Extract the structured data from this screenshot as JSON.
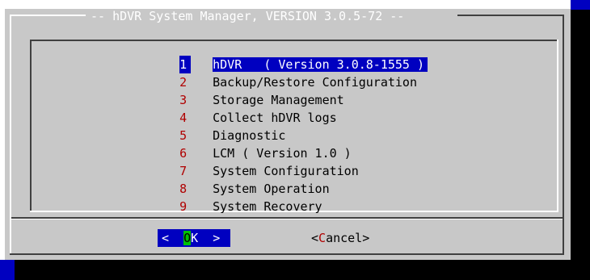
{
  "dialog": {
    "title": "-- hDVR System Manager, VERSION 3.0.5-72 --"
  },
  "menu": {
    "items": [
      {
        "tag": "1",
        "label": "hDVR   ( Version 3.0.8-1555 )",
        "selected": true
      },
      {
        "tag": "2",
        "label": "Backup/Restore Configuration",
        "selected": false
      },
      {
        "tag": "3",
        "label": "Storage Management",
        "selected": false
      },
      {
        "tag": "4",
        "label": "Collect hDVR logs",
        "selected": false
      },
      {
        "tag": "5",
        "label": "Diagnostic",
        "selected": false
      },
      {
        "tag": "6",
        "label": "LCM ( Version 1.0 )",
        "selected": false
      },
      {
        "tag": "7",
        "label": "System Configuration",
        "selected": false
      },
      {
        "tag": "8",
        "label": "System Operation",
        "selected": false
      },
      {
        "tag": "9",
        "label": "System Recovery",
        "selected": false
      }
    ]
  },
  "buttons": {
    "ok": {
      "left": "<  ",
      "hotkey": "O",
      "rest": "K  >"
    },
    "cancel": {
      "left": "<",
      "hotkey": "C",
      "rest": "ancel>"
    }
  },
  "colors": {
    "dialog_bg": "#c8c8c8",
    "selection_bg": "#0000c0",
    "hotkey_fg": "#b00000",
    "ok_hotkey_bg": "#00c000"
  }
}
